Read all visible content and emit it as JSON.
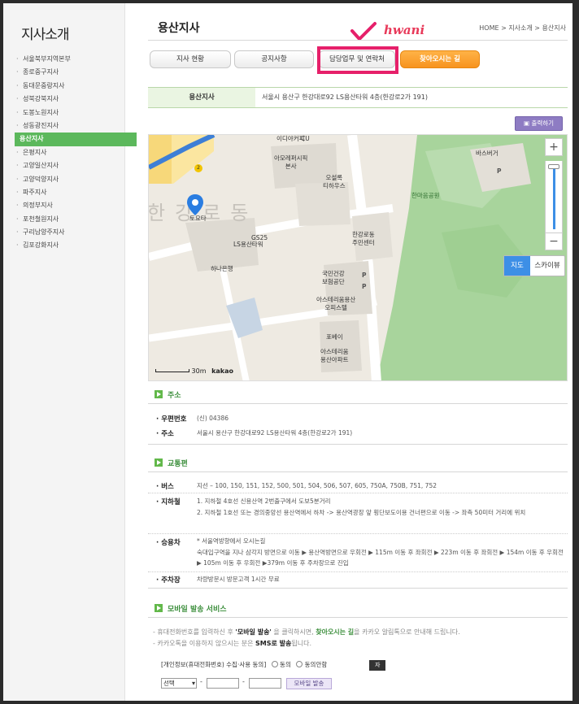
{
  "sidebar": {
    "title": "지사소개",
    "items": [
      {
        "label": "서울북부지역본부"
      },
      {
        "label": "종로중구지사"
      },
      {
        "label": "동대문중랑지사"
      },
      {
        "label": "성북강북지사"
      },
      {
        "label": "도봉노원지사"
      },
      {
        "label": "성동광진지사"
      },
      {
        "label": "용산지사",
        "active": true
      },
      {
        "label": "은평지사"
      },
      {
        "label": "고양일산지사"
      },
      {
        "label": "고양덕양지사"
      },
      {
        "label": "파주지사"
      },
      {
        "label": "의정부지사"
      },
      {
        "label": "포천철원지사"
      },
      {
        "label": "구리남양주지사"
      },
      {
        "label": "김포강화지사"
      }
    ]
  },
  "header": {
    "title": "용산지사",
    "breadcrumb": "HOME > 지사소개 > 용산지사",
    "annotation": "hwani"
  },
  "tabs": [
    {
      "label": "지사 현황"
    },
    {
      "label": "공지사항"
    },
    {
      "label": "담당업무 및 연락처"
    },
    {
      "label": "찾아오시는 길"
    }
  ],
  "address_bar": {
    "label": "용산지사",
    "value": "서울시 용산구 한강대로92 LS용산타워 4층(한강로2가 191)"
  },
  "print_label": "출력하기",
  "map": {
    "big_text": "한강로동",
    "labels": {
      "ediya": "이디야커피",
      "cu": "CU",
      "amore": "아모레퍼시픽\n본사",
      "osulloc": "오설록\n티하우스",
      "burger": "바스버거",
      "park": "한마음공원",
      "toeta": "토요타",
      "gs25": "GS25",
      "lstower": "LS용산타워",
      "hana": "하나은행",
      "center": "한강로동\n주민센터",
      "nhis": "국민건강\n보험공단",
      "asterium_office": "아스테리움용산\n오피스텔",
      "pobei": "포베이",
      "asterium_apt": "아스테리움\n용산아파트",
      "p1": "P",
      "p2": "P",
      "p3": "P",
      "subway": "2"
    },
    "zoom_in": "+",
    "zoom_out": "−",
    "maptype_map": "지도",
    "maptype_sky": "스카이뷰",
    "scale": "30m",
    "brand": "kakao"
  },
  "address_section": {
    "title": "주소",
    "postal_label": "우편번호",
    "postal_value": "(신) 04386",
    "addr_label": "주소",
    "addr_value": "서울시 용산구 한강대로92 LS용산타워 4층(한강로2가 191)"
  },
  "transport": {
    "title": "교통편",
    "bus_label": "버스",
    "bus_value": "지선 – 100, 150, 151, 152, 500, 501, 504, 506, 507, 605, 750A, 750B, 751, 752",
    "subway_label": "지하철",
    "subway_line1": "1. 지하철 4호선 신용산역 2번출구에서 도보5분거리",
    "subway_line2": "2. 지하철 1호선 또는 경의중앙선 용산역에서 하차 -> 용산역광장 앞 횡단보도이용 건너편으로 이동 -> 좌측 50미터 거리에 위치",
    "car_label": "승용차",
    "car_line1": "* 서울역방향에서 오시는길",
    "car_line2": "숙대입구역을 지나 삼각지 방면으로 이동 ▶ 용산역방면으로 우회전 ▶ 115m 이동 후 좌회전 ▶ 223m 이동 후 좌회전 ▶ 154m 이동 후 우회전 ▶ 105m 이동 후 우회전 ▶379m 이동 후 주차장으로 진입",
    "parking_label": "주차장",
    "parking_value": "차량방문시 방문고객 1시간 무료"
  },
  "mobile": {
    "title": "모바일 발송 서비스",
    "info1_pre": "- 휴대전화번호를 입력하신 후  ",
    "info1_btn": "'모바일 발송'",
    "info1_mid": "  을 클릭하시면, ",
    "info1_hl": "찾아오시는 길",
    "info1_post": "을 카카오 알림톡으로 안내해 드립니다.",
    "info2_pre": "- 카카오톡을 이용하지 않으시는 분은 ",
    "info2_hl": "SMS로 발송",
    "info2_post": "됩니다.",
    "consent_label": "[개인정보(휴대전화번호) 수집·사용 동의]",
    "agree": "동의",
    "disagree": "동의안함",
    "detail_btn": "자세히 보기",
    "select_value": "선택",
    "dash": "-",
    "send_btn": "모바일 발송"
  }
}
